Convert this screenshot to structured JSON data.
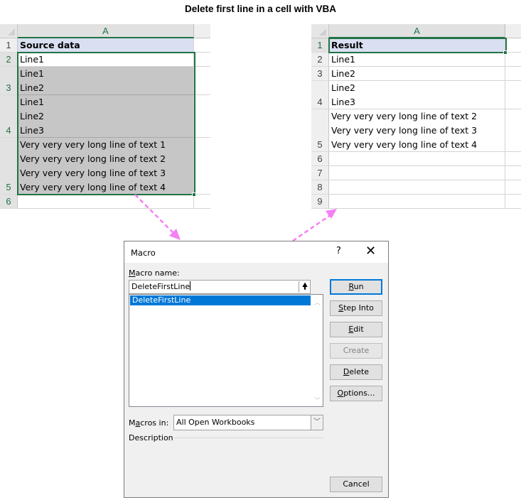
{
  "title": "Delete first line in a cell with VBA",
  "source_sheet": {
    "column_header": "A",
    "rows": [
      {
        "num": "1",
        "lines": [
          "Source data"
        ],
        "header": true
      },
      {
        "num": "2",
        "lines": [
          "Line1"
        ]
      },
      {
        "num": "3",
        "lines": [
          "Line1",
          "Line2"
        ]
      },
      {
        "num": "4",
        "lines": [
          "Line1",
          "Line2",
          "Line3"
        ]
      },
      {
        "num": "5",
        "lines": [
          "Very very very long line of text 1",
          "Very very very long line of text 2",
          "Very very very long line of text 3",
          "Very very very long line of text 4"
        ]
      },
      {
        "num": "6",
        "lines": [
          ""
        ]
      }
    ]
  },
  "result_sheet": {
    "column_header": "A",
    "rows": [
      {
        "num": "1",
        "lines": [
          "Result"
        ],
        "header": true
      },
      {
        "num": "2",
        "lines": [
          "Line1"
        ]
      },
      {
        "num": "3",
        "lines": [
          "Line2"
        ]
      },
      {
        "num": "4",
        "lines": [
          "Line2",
          "Line3"
        ]
      },
      {
        "num": "5",
        "lines": [
          "Very very very long line of text 2",
          "Very very very long line of text 3",
          "Very very very long line of text 4"
        ]
      },
      {
        "num": "6",
        "lines": [
          ""
        ]
      },
      {
        "num": "7",
        "lines": [
          ""
        ]
      },
      {
        "num": "8",
        "lines": [
          ""
        ]
      },
      {
        "num": "9",
        "lines": [
          ""
        ]
      }
    ]
  },
  "dialog": {
    "title": "Macro",
    "help": "?",
    "close": "✕",
    "macro_name_label_u": "M",
    "macro_name_label_rest": "acro name:",
    "macro_name_value": "DeleteFirstLine",
    "macro_list": [
      "DeleteFirstLine"
    ],
    "buttons": {
      "run_u": "R",
      "run_rest": "un",
      "step_into_u": "S",
      "step_into_rest": "tep Into",
      "edit_u": "E",
      "edit_rest": "dit",
      "create": "Create",
      "delete_u": "D",
      "delete_rest": "elete",
      "options_u": "O",
      "options_rest": "ptions...",
      "cancel": "Cancel"
    },
    "macros_in_label_a": "M",
    "macros_in_label_u": "a",
    "macros_in_label_rest": "cros in:",
    "macros_in_value": "All Open Workbooks",
    "description_label": "Description"
  },
  "colors": {
    "excel_green": "#217346",
    "arrow_pink": "#f57ff5",
    "selection_blue": "#0078d7"
  }
}
